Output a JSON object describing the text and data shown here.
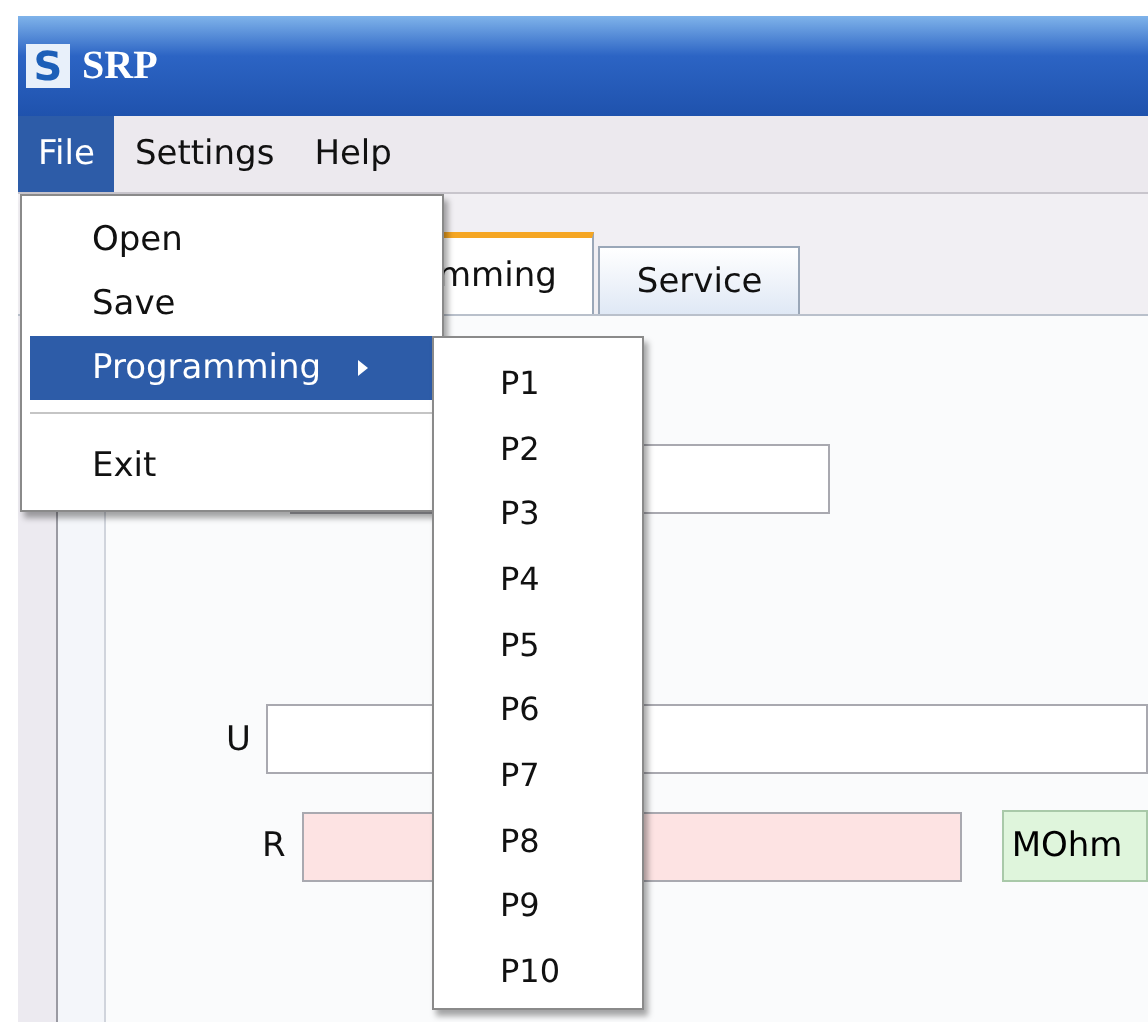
{
  "window": {
    "logo": "S",
    "title": "SRP"
  },
  "menu_bar": [
    {
      "label": "File",
      "selected": true
    },
    {
      "label": "Settings",
      "selected": false
    },
    {
      "label": "Help",
      "selected": false
    }
  ],
  "tabs": [
    {
      "label": "mming",
      "selected": true
    },
    {
      "label": "Service",
      "selected": false
    }
  ],
  "fields": [
    {
      "label": "U",
      "kind": "plain"
    },
    {
      "label": "R",
      "kind": "error",
      "unit": "MOhm"
    }
  ],
  "file_menu": [
    {
      "kind": "item",
      "label": "Open",
      "selected": false
    },
    {
      "kind": "item",
      "label": "Save",
      "selected": false
    },
    {
      "kind": "submenu",
      "label": "Programming",
      "selected": true
    },
    {
      "kind": "separator"
    },
    {
      "kind": "item",
      "label": "Exit",
      "selected": false
    }
  ],
  "submenu": [
    "P1",
    "P2",
    "P3",
    "P4",
    "P5",
    "P6",
    "P7",
    "P8",
    "P9",
    "P10"
  ]
}
